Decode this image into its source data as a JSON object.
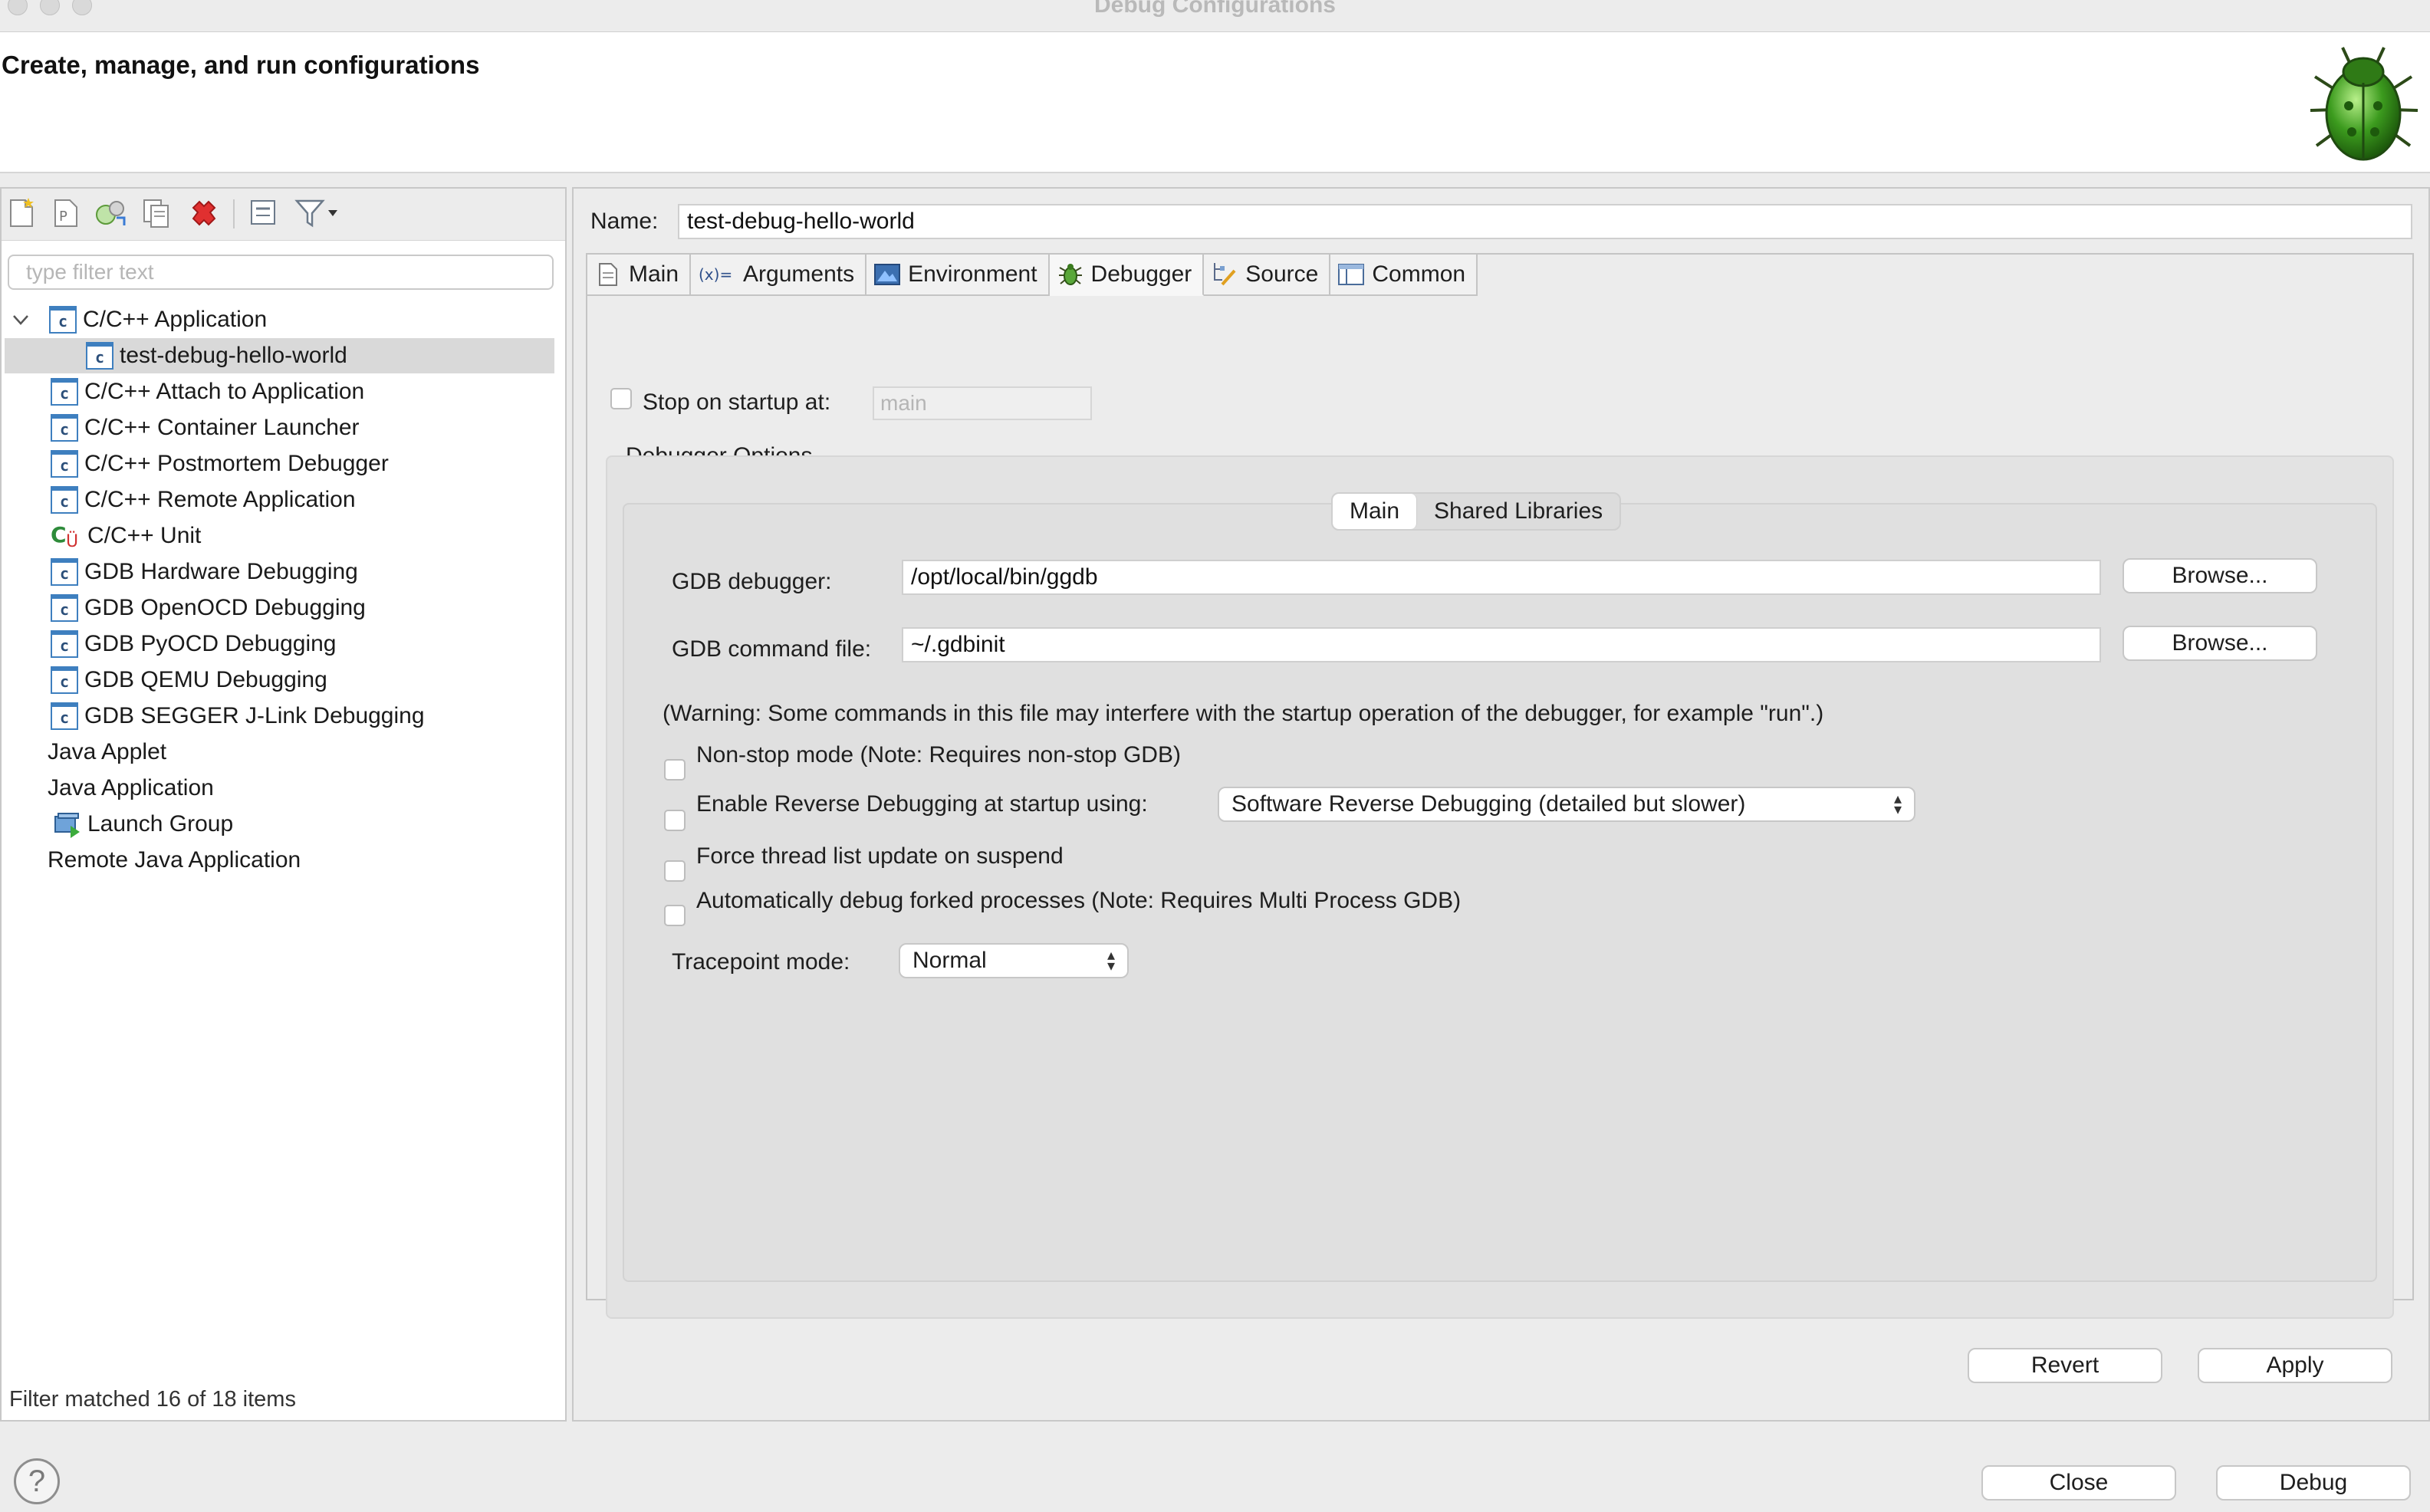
{
  "window": {
    "title": "Debug Configurations"
  },
  "header": {
    "title": "Create, manage, and run configurations",
    "banner_icon": "bug-icon"
  },
  "left_toolbar": {
    "icons": [
      "new-configuration-icon",
      "new-prototype-icon",
      "export-icon",
      "duplicate-icon",
      "delete-icon",
      "collapse-all-icon",
      "filter-icon",
      "dropdown-arrow-icon"
    ]
  },
  "filter": {
    "placeholder": "type filter text",
    "value": ""
  },
  "tree": {
    "items": [
      {
        "label": "C/C++ Application",
        "icon": "c-app-icon",
        "level": 0,
        "expanded": true
      },
      {
        "label": "test-debug-hello-world",
        "icon": "c-app-icon",
        "level": 1,
        "selected": true
      },
      {
        "label": "C/C++ Attach to Application",
        "icon": "c-app-icon",
        "level": 0
      },
      {
        "label": "C/C++ Container Launcher",
        "icon": "c-app-icon",
        "level": 0
      },
      {
        "label": "C/C++ Postmortem Debugger",
        "icon": "c-app-icon",
        "level": 0
      },
      {
        "label": "C/C++ Remote Application",
        "icon": "c-app-icon",
        "level": 0
      },
      {
        "label": "C/C++ Unit",
        "icon": "c-unit-icon",
        "level": 0
      },
      {
        "label": "GDB Hardware Debugging",
        "icon": "c-app-icon",
        "level": 0
      },
      {
        "label": "GDB OpenOCD Debugging",
        "icon": "c-app-icon",
        "level": 0
      },
      {
        "label": "GDB PyOCD Debugging",
        "icon": "c-app-icon",
        "level": 0
      },
      {
        "label": "GDB QEMU Debugging",
        "icon": "c-app-icon",
        "level": 0
      },
      {
        "label": "GDB SEGGER J-Link Debugging",
        "icon": "c-app-icon",
        "level": 0
      },
      {
        "label": "Java Applet",
        "icon": "",
        "level": 0
      },
      {
        "label": "Java Application",
        "icon": "",
        "level": 0
      },
      {
        "label": "Launch Group",
        "icon": "launch-group-icon",
        "level": 0
      },
      {
        "label": "Remote Java Application",
        "icon": "",
        "level": 0
      }
    ],
    "status": "Filter matched 16 of 18 items"
  },
  "config": {
    "name_label": "Name:",
    "name_value": "test-debug-hello-world",
    "tabs": [
      {
        "label": "Main",
        "icon": "main-tab-icon"
      },
      {
        "label": "Arguments",
        "icon": "arguments-tab-icon"
      },
      {
        "label": "Environment",
        "icon": "environment-tab-icon"
      },
      {
        "label": "Debugger",
        "icon": "debugger-tab-icon",
        "active": true
      },
      {
        "label": "Source",
        "icon": "source-tab-icon"
      },
      {
        "label": "Common",
        "icon": "common-tab-icon"
      }
    ],
    "stop_on_startup": {
      "label": "Stop on startup at:",
      "checked": false,
      "value": "main"
    },
    "debugger_options_label": "Debugger Options",
    "subtabs": [
      {
        "label": "Main",
        "active": true
      },
      {
        "label": "Shared Libraries"
      }
    ],
    "gdb_debugger": {
      "label": "GDB debugger:",
      "value": "/opt/local/bin/ggdb"
    },
    "gdb_command_file": {
      "label": "GDB command file:",
      "value": "~/.gdbinit"
    },
    "browse_label": "Browse...",
    "warning": "(Warning: Some commands in this file may interfere with the startup operation of the debugger, for example \"run\".)",
    "non_stop": {
      "label": "Non-stop mode (Note: Requires non-stop GDB)",
      "checked": false
    },
    "reverse": {
      "label": "Enable Reverse Debugging at startup using:",
      "checked": false,
      "selected": "Software Reverse Debugging (detailed but slower)"
    },
    "force_thread": {
      "label": "Force thread list update on suspend",
      "checked": false
    },
    "auto_fork": {
      "label": "Automatically debug forked processes (Note: Requires Multi Process GDB)",
      "checked": false
    },
    "tracepoint": {
      "label": "Tracepoint mode:",
      "selected": "Normal"
    },
    "revert_label": "Revert",
    "apply_label": "Apply"
  },
  "footer": {
    "close_label": "Close",
    "debug_label": "Debug",
    "help_icon": "help-icon"
  }
}
